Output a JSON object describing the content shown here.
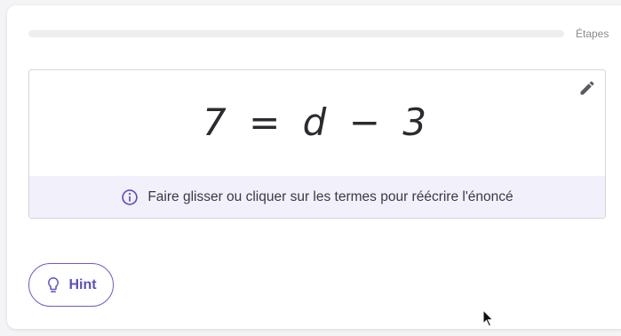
{
  "progress": {
    "label": "Étapes",
    "value": 0
  },
  "equation": {
    "lhs": "7",
    "eq": "=",
    "var": "d",
    "op": "−",
    "rhs": "3"
  },
  "info": {
    "text": "Faire glisser ou cliquer sur les termes pour réécrire l'énoncé",
    "icon": "info-circle-icon"
  },
  "hint": {
    "label": "Hint",
    "icon": "lightbulb-icon"
  },
  "edit": {
    "icon": "pencil-icon"
  },
  "colors": {
    "accent": "#6a5acd",
    "info_bg": "#f2f0fb",
    "track": "#eeeef1"
  }
}
